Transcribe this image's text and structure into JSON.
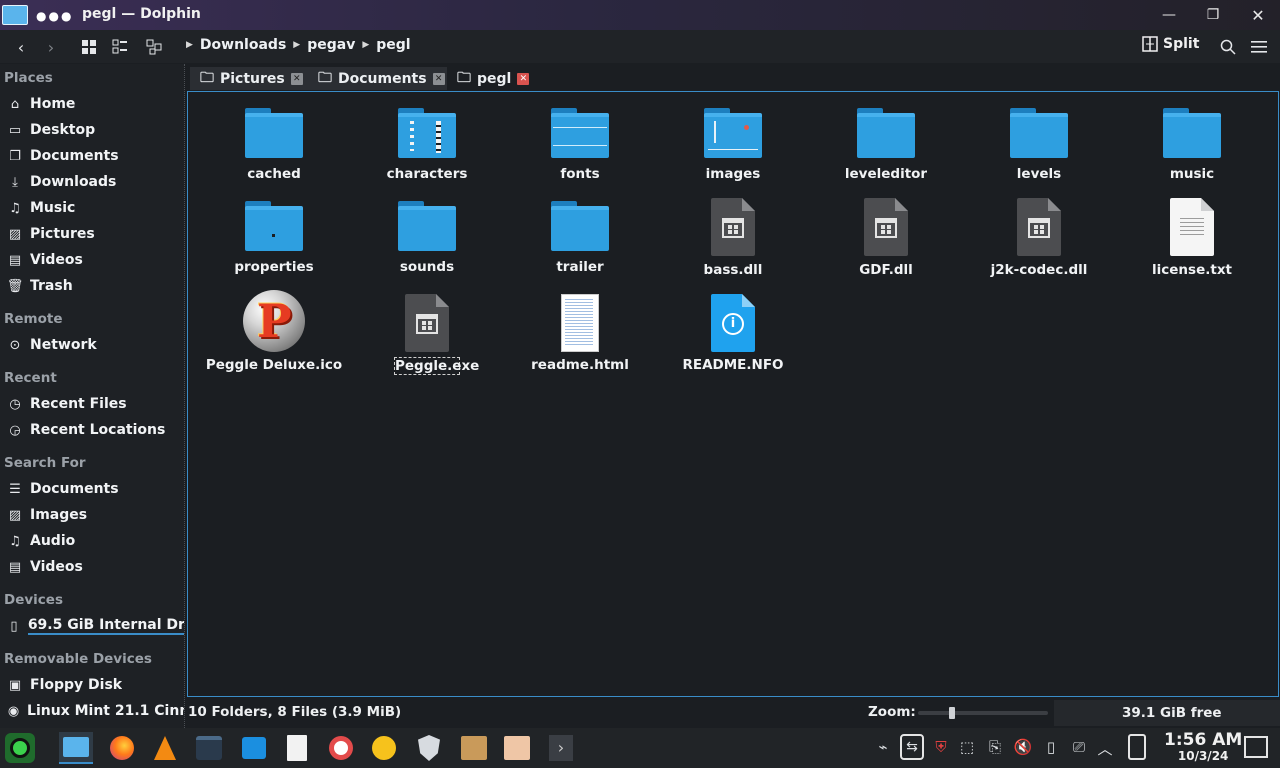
{
  "window": {
    "title": "pegl — Dolphin",
    "dots": "●●●"
  },
  "toolbar": {
    "breadcrumb": [
      "Downloads",
      "pegav",
      "pegl"
    ],
    "split_label": "Split"
  },
  "sidebar": {
    "sections": [
      {
        "heading": "Places",
        "items": [
          {
            "label": "Home",
            "icon": "home-icon"
          },
          {
            "label": "Desktop",
            "icon": "desktop-icon"
          },
          {
            "label": "Documents",
            "icon": "documents-icon"
          },
          {
            "label": "Downloads",
            "icon": "downloads-icon"
          },
          {
            "label": "Music",
            "icon": "music-icon"
          },
          {
            "label": "Pictures",
            "icon": "pictures-icon"
          },
          {
            "label": "Videos",
            "icon": "videos-icon"
          },
          {
            "label": "Trash",
            "icon": "trash-icon"
          }
        ]
      },
      {
        "heading": "Remote",
        "items": [
          {
            "label": "Network",
            "icon": "network-icon"
          }
        ]
      },
      {
        "heading": "Recent",
        "items": [
          {
            "label": "Recent Files",
            "icon": "recent-files-icon"
          },
          {
            "label": "Recent Locations",
            "icon": "recent-locations-icon"
          }
        ]
      },
      {
        "heading": "Search For",
        "items": [
          {
            "label": "Documents",
            "icon": "documents-search-icon"
          },
          {
            "label": "Images",
            "icon": "images-icon"
          },
          {
            "label": "Audio",
            "icon": "audio-icon"
          },
          {
            "label": "Videos",
            "icon": "videos-search-icon"
          }
        ]
      },
      {
        "heading": "Devices",
        "items": [
          {
            "label": "69.5 GiB Internal Dri...",
            "icon": "drive-icon"
          }
        ]
      },
      {
        "heading": "Removable Devices",
        "items": [
          {
            "label": "Floppy Disk",
            "icon": "floppy-icon"
          },
          {
            "label": "Linux Mint 21.1 Cinna...",
            "icon": "optical-disc-icon"
          }
        ]
      }
    ]
  },
  "tabs": [
    {
      "label": "Pictures",
      "active": false
    },
    {
      "label": "Documents",
      "active": false
    },
    {
      "label": "pegl",
      "active": true
    }
  ],
  "files": [
    {
      "name": "cached",
      "kind": "folder"
    },
    {
      "name": "characters",
      "kind": "folder"
    },
    {
      "name": "fonts",
      "kind": "folder"
    },
    {
      "name": "images",
      "kind": "folder"
    },
    {
      "name": "leveleditor",
      "kind": "folder"
    },
    {
      "name": "levels",
      "kind": "folder"
    },
    {
      "name": "music",
      "kind": "folder"
    },
    {
      "name": "properties",
      "kind": "folder"
    },
    {
      "name": "sounds",
      "kind": "folder"
    },
    {
      "name": "trailer",
      "kind": "folder"
    },
    {
      "name": "bass.dll",
      "kind": "dll"
    },
    {
      "name": "GDF.dll",
      "kind": "dll"
    },
    {
      "name": "j2k-codec.dll",
      "kind": "dll"
    },
    {
      "name": "license.txt",
      "kind": "text"
    },
    {
      "name": "Peggle Deluxe.ico",
      "kind": "ico"
    },
    {
      "name": "Peggle.exe",
      "kind": "exe",
      "focused": true
    },
    {
      "name": "readme.html",
      "kind": "html"
    },
    {
      "name": "README.NFO",
      "kind": "info"
    }
  ],
  "status": {
    "summary": "10 Folders, 8 Files (3.9 MiB)",
    "zoom_label": "Zoom:",
    "zoom_level": 0.25,
    "free_space": "39.1 GiB free"
  },
  "panel": {
    "clock_time": "1:56 AM",
    "clock_date": "10/3/24"
  }
}
